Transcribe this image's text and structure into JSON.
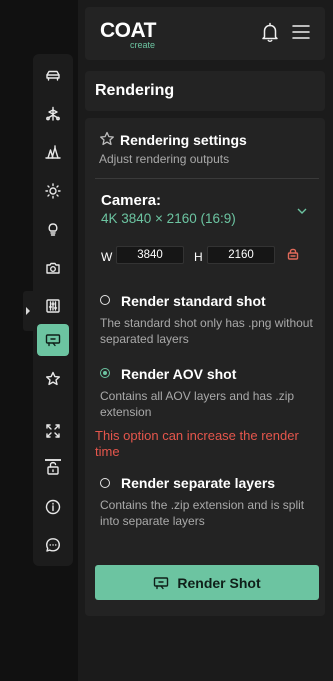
{
  "colors": {
    "accent": "#6cc4a1",
    "warning": "#e5564c",
    "lock": "#e06a5a",
    "panel": "#232323",
    "background": "#111111"
  },
  "header": {
    "logo_main": "COAT",
    "logo_sub": "create",
    "icons": [
      "bell-icon",
      "menu-icon"
    ]
  },
  "sidebar": {
    "items": [
      {
        "icon": "car-icon",
        "active": false
      },
      {
        "icon": "tree-node-icon",
        "active": false
      },
      {
        "icon": "landscape-icon",
        "active": false
      },
      {
        "icon": "sun-icon",
        "active": false
      },
      {
        "icon": "lightbulb-icon",
        "active": false
      },
      {
        "icon": "camera-icon",
        "active": false
      },
      {
        "icon": "sliders-icon",
        "active": false
      },
      {
        "icon": "render-icon",
        "active": true
      },
      {
        "icon": "star-icon",
        "active": false
      },
      {
        "icon": "expand-icon",
        "active": false
      },
      {
        "icon": "unlock-icon",
        "active": false
      },
      {
        "icon": "info-icon",
        "active": false
      },
      {
        "icon": "chat-icon",
        "active": false
      }
    ]
  },
  "section": {
    "title": "Rendering"
  },
  "settings": {
    "title": "Rendering settings",
    "subtitle": "Adjust rendering outputs",
    "camera_label": "Camera:",
    "camera_value": "4K 3840 × 2160 (16:9)",
    "width_label": "W",
    "width_value": "3840",
    "height_label": "H",
    "height_value": "2160",
    "aspect_locked": true
  },
  "options": [
    {
      "title": "Render standard shot",
      "desc": "The standard shot only has .png without separated layers",
      "checked": false
    },
    {
      "title": "Render AOV shot",
      "desc": "Contains all AOV layers and has .zip extension",
      "checked": true
    },
    {
      "title": "Render separate layers",
      "desc": "Contains the .zip extension and is split into separate layers",
      "checked": false
    }
  ],
  "warning": "This option can increase the render time",
  "render_button": {
    "label": "Render Shot"
  }
}
